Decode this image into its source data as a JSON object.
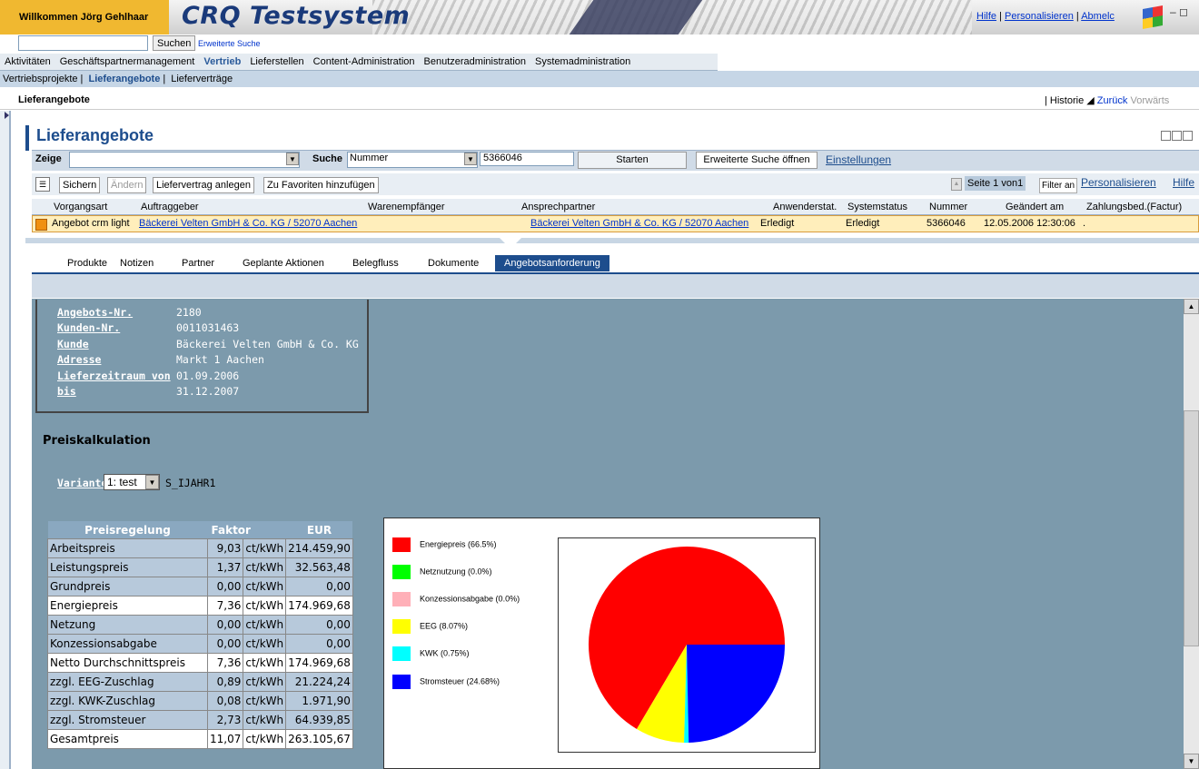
{
  "header": {
    "welcome": "Willkommen Jörg Gehlhaar",
    "brand": "CRQ Testsystem",
    "links": [
      "Hilfe",
      "Personalisieren",
      "Abmelc"
    ],
    "window_controls": "– ◻"
  },
  "search": {
    "button": "Suchen",
    "advanced": "Erweiterte Suche",
    "value": ""
  },
  "nav": {
    "level1": [
      "Aktivitäten",
      "Geschäftspartnermanagement",
      "Vertrieb",
      "Lieferstellen",
      "Content-Administration",
      "Benutzeradministration",
      "Systemadministration"
    ],
    "level1_active": 2,
    "level2": [
      "Vertriebsprojekte",
      "Lieferangebote",
      "Lieferverträge"
    ],
    "level2_active": 1
  },
  "crumb": {
    "page": "Lieferangebote",
    "historie": "Historie",
    "zurueck": "Zurück",
    "vorwaerts": "Vorwärts"
  },
  "page": {
    "title": "Lieferangebote"
  },
  "filter": {
    "zeige_label": "Zeige",
    "zeige_value": "",
    "suche_label": "Suche",
    "suche_field": "Nummer",
    "suche_value": "5366046",
    "starten": "Starten",
    "erweitert": "Erweiterte Suche öffnen",
    "einstellungen": "Einstellungen"
  },
  "toolbar": {
    "sichern": "Sichern",
    "aendern": "Ändern",
    "liefervertrag": "Liefervertrag anlegen",
    "favoriten": "Zu Favoriten hinzufügen",
    "seite": "Seite",
    "page_num": "1",
    "von": "von",
    "total": "1",
    "filter_an": "Filter an",
    "personalisieren": "Personalisieren",
    "hilfe": "Hilfe"
  },
  "table": {
    "columns": [
      "Vorgangsart",
      "Auftraggeber",
      "Warenempfänger",
      "Ansprechpartner",
      "Anwenderstat.",
      "Systemstatus",
      "Nummer",
      "Geändert am",
      "Zahlungsbed.(Factur)"
    ],
    "row": {
      "vorgangsart": "Angebot crm light",
      "auftraggeber": "Bäckerei Velten GmbH & Co. KG / 52070 Aachen",
      "warenempfaenger": "",
      "ansprechpartner": "Bäckerei Velten GmbH & Co. KG / 52070 Aachen",
      "anwenderstat": "Erledigt",
      "systemstatus": "Erledigt",
      "nummer": "5366046",
      "geaendert": "12.05.2006 12:30:06",
      "zahlung": "."
    }
  },
  "tabs": [
    "Produkte",
    "Notizen",
    "Partner",
    "Geplante Aktionen",
    "Belegfluss",
    "Dokumente",
    "Angebotsanforderung"
  ],
  "tabs_active": 6,
  "info": {
    "labels": [
      "Angebots-Nr.",
      "Kunden-Nr.",
      "Kunde",
      "Adresse",
      "Lieferzeitraum von",
      "bis"
    ],
    "values": [
      "2180",
      "0011031463",
      "Bäckerei Velten GmbH & Co. KG",
      "Markt 1 Aachen",
      "01.09.2006",
      "31.12.2007"
    ]
  },
  "preis": {
    "title": "Preiskalkulation",
    "variante_label": "Variante",
    "variante_value": "1: test",
    "variante_code": "S_IJAHR1",
    "headers": [
      "Preisregelung",
      "Faktor",
      "",
      "EUR"
    ],
    "rows": [
      {
        "name": "Arbeitspreis",
        "faktor": "9,03",
        "unit": "ct/kWh",
        "eur": "214.459,90",
        "style": "alt"
      },
      {
        "name": "Leistungspreis",
        "faktor": "1,37",
        "unit": "ct/kWh",
        "eur": "32.563,48",
        "style": "alt"
      },
      {
        "name": "Grundpreis",
        "faktor": "0,00",
        "unit": "ct/kWh",
        "eur": "0,00",
        "style": "alt"
      },
      {
        "name": "Energiepreis",
        "faktor": "7,36",
        "unit": "ct/kWh",
        "eur": "174.969,68",
        "style": "wht"
      },
      {
        "name": "Netzung",
        "faktor": "0,00",
        "unit": "ct/kWh",
        "eur": "0,00",
        "style": "alt"
      },
      {
        "name": "Konzessionsabgabe",
        "faktor": "0,00",
        "unit": "ct/kWh",
        "eur": "0,00",
        "style": "alt"
      },
      {
        "name": "Netto Durchschnittspreis",
        "faktor": "7,36",
        "unit": "ct/kWh",
        "eur": "174.969,68",
        "style": "wht"
      },
      {
        "name": "zzgl. EEG-Zuschlag",
        "faktor": "0,89",
        "unit": "ct/kWh",
        "eur": "21.224,24",
        "style": "alt"
      },
      {
        "name": "zzgl. KWK-Zuschlag",
        "faktor": "0,08",
        "unit": "ct/kWh",
        "eur": "1.971,90",
        "style": "alt"
      },
      {
        "name": "zzgl. Stromsteuer",
        "faktor": "2,73",
        "unit": "ct/kWh",
        "eur": "64.939,85",
        "style": "alt"
      },
      {
        "name": "Gesamtpreis",
        "faktor": "11,07",
        "unit": "ct/kWh",
        "eur": "263.105,67",
        "style": "wht"
      }
    ]
  },
  "chart_data": {
    "type": "pie",
    "title": "",
    "legend_position": "left",
    "slices": [
      {
        "label": "Energiepreis (66.5%)",
        "value": 66.5,
        "color": "#ff0000"
      },
      {
        "label": "Netznutzung (0.0%)",
        "value": 0.0,
        "color": "#00ff00"
      },
      {
        "label": "Konzessionsabgabe (0.0%)",
        "value": 0.0,
        "color": "#ffb0b8"
      },
      {
        "label": "EEG (8.07%)",
        "value": 8.07,
        "color": "#ffff00"
      },
      {
        "label": "KWK (0.75%)",
        "value": 0.75,
        "color": "#00ffff"
      },
      {
        "label": "Stromsteuer (24.68%)",
        "value": 24.68,
        "color": "#0000ff"
      }
    ]
  }
}
